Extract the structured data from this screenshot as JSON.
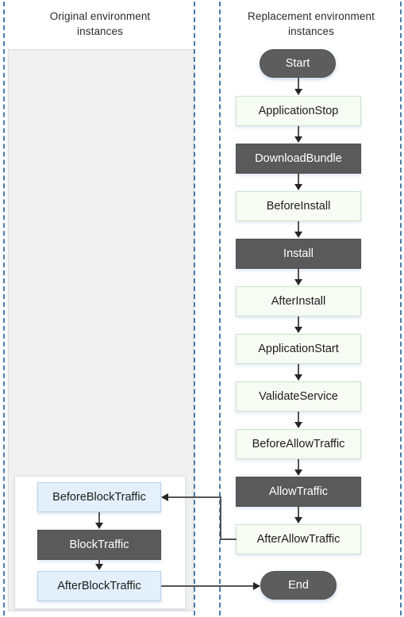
{
  "diagram": {
    "title_left": "Original environment instances",
    "title_right": "Replacement environment instances",
    "lanes": {
      "left": {
        "label_line1": "Original environment",
        "label_line2": "instances"
      },
      "right": {
        "label_line1": "Replacement environment",
        "label_line2": "instances"
      }
    },
    "colors": {
      "lane_border": "#4b7ba8",
      "pool_fill": "#f1f1f1",
      "node_green_fill": "#f6fbf4",
      "node_green_border": "#cfe3cb",
      "node_blue_fill": "#e3effa",
      "node_blue_border": "#b9d3ea",
      "node_dark_fill": "#5a5a5a",
      "terminator_fill": "#5d5d5d",
      "connector": "#545454"
    },
    "right_lane_nodes": [
      {
        "id": "start",
        "label": "Start",
        "style": "terminator"
      },
      {
        "id": "application-stop",
        "label": "ApplicationStop",
        "style": "green"
      },
      {
        "id": "download-bundle",
        "label": "DownloadBundle",
        "style": "dark"
      },
      {
        "id": "before-install",
        "label": "BeforeInstall",
        "style": "green"
      },
      {
        "id": "install",
        "label": "Install",
        "style": "dark"
      },
      {
        "id": "after-install",
        "label": "AfterInstall",
        "style": "green"
      },
      {
        "id": "application-start",
        "label": "ApplicationStart",
        "style": "green"
      },
      {
        "id": "validate-service",
        "label": "ValidateService",
        "style": "green"
      },
      {
        "id": "before-allow-traffic",
        "label": "BeforeAllowTraffic",
        "style": "green"
      },
      {
        "id": "allow-traffic",
        "label": "AllowTraffic",
        "style": "dark"
      },
      {
        "id": "after-allow-traffic",
        "label": "AfterAllowTraffic",
        "style": "green"
      },
      {
        "id": "end",
        "label": "End",
        "style": "terminator"
      }
    ],
    "left_lane_nodes": [
      {
        "id": "before-block-traffic",
        "label": "BeforeBlockTraffic",
        "style": "blue"
      },
      {
        "id": "block-traffic",
        "label": "BlockTraffic",
        "style": "dark"
      },
      {
        "id": "after-block-traffic",
        "label": "AfterBlockTraffic",
        "style": "blue"
      }
    ],
    "edges": [
      {
        "from": "start",
        "to": "application-stop",
        "direction": "down"
      },
      {
        "from": "application-stop",
        "to": "download-bundle",
        "direction": "down"
      },
      {
        "from": "download-bundle",
        "to": "before-install",
        "direction": "down"
      },
      {
        "from": "before-install",
        "to": "install",
        "direction": "down"
      },
      {
        "from": "install",
        "to": "after-install",
        "direction": "down"
      },
      {
        "from": "after-install",
        "to": "application-start",
        "direction": "down"
      },
      {
        "from": "application-start",
        "to": "validate-service",
        "direction": "down"
      },
      {
        "from": "validate-service",
        "to": "before-allow-traffic",
        "direction": "down"
      },
      {
        "from": "before-allow-traffic",
        "to": "allow-traffic",
        "direction": "down"
      },
      {
        "from": "allow-traffic",
        "to": "after-allow-traffic",
        "direction": "down"
      },
      {
        "from": "after-allow-traffic",
        "to": "before-block-traffic",
        "direction": "left"
      },
      {
        "from": "before-block-traffic",
        "to": "block-traffic",
        "direction": "down"
      },
      {
        "from": "block-traffic",
        "to": "after-block-traffic",
        "direction": "down"
      },
      {
        "from": "after-block-traffic",
        "to": "end",
        "direction": "right"
      }
    ]
  }
}
